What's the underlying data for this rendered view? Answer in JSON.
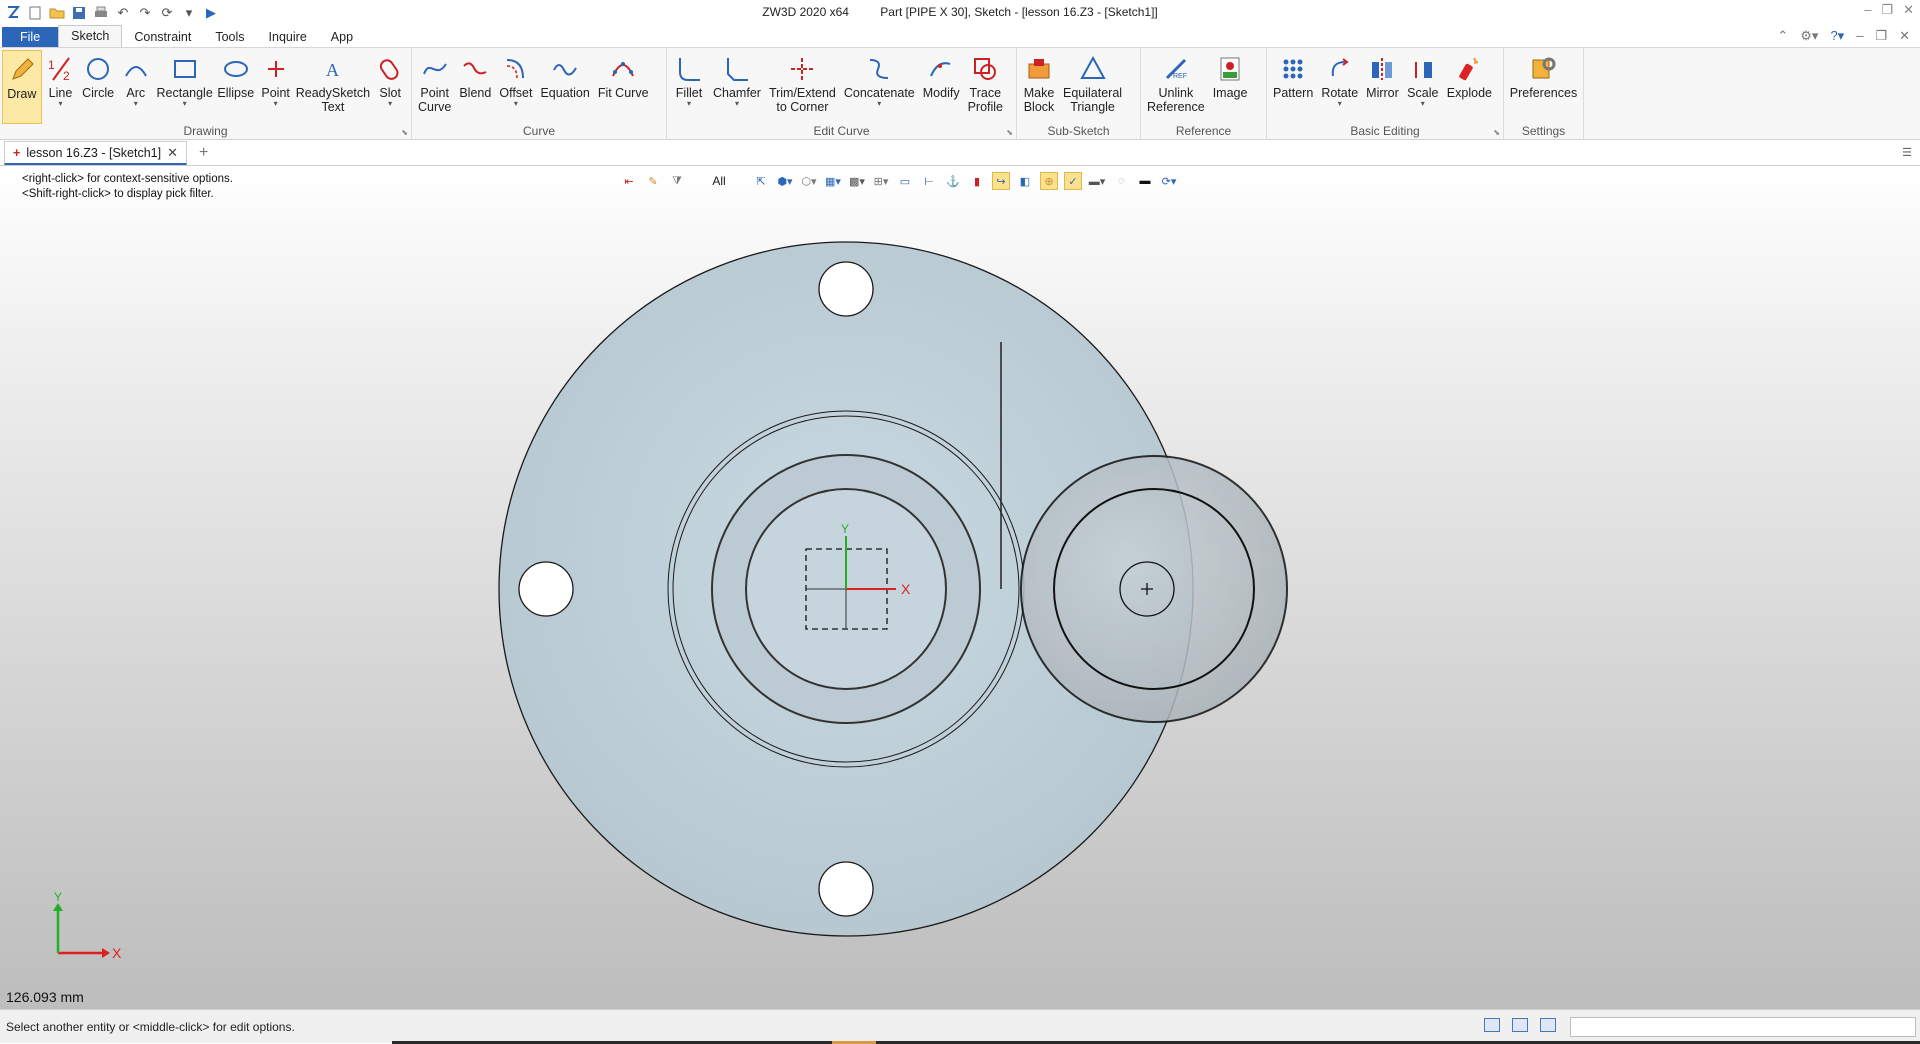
{
  "window": {
    "app_title": "ZW3D 2020 x64",
    "doc_title": "Part [PIPE X 30],  Sketch - [lesson 16.Z3 - [Sketch1]]"
  },
  "menu": {
    "tabs": [
      "File",
      "Sketch",
      "Constraint",
      "Tools",
      "Inquire",
      "App"
    ],
    "active": "Sketch"
  },
  "ribbon": {
    "groups": [
      {
        "title": "Drawing",
        "buttons": [
          {
            "label": "Draw"
          },
          {
            "label": "Line"
          },
          {
            "label": "Circle"
          },
          {
            "label": "Arc"
          },
          {
            "label": "Rectangle"
          },
          {
            "label": "Ellipse"
          },
          {
            "label": "Point"
          },
          {
            "label": "ReadySketch",
            "label2": "Text"
          },
          {
            "label": "Slot"
          }
        ]
      },
      {
        "title": "Curve",
        "buttons": [
          {
            "label": "Point",
            "label2": "Curve"
          },
          {
            "label": "Blend"
          },
          {
            "label": "Offset"
          },
          {
            "label": "Equation"
          },
          {
            "label": "Fit Curve"
          }
        ]
      },
      {
        "title": "Edit Curve",
        "buttons": [
          {
            "label": "Fillet"
          },
          {
            "label": "Chamfer"
          },
          {
            "label": "Trim/Extend",
            "label2": "to Corner"
          },
          {
            "label": "Concatenate"
          },
          {
            "label": "Modify"
          },
          {
            "label": "Trace",
            "label2": "Profile"
          }
        ]
      },
      {
        "title": "Sub-Sketch",
        "buttons": [
          {
            "label": "Make",
            "label2": "Block"
          },
          {
            "label": "Equilateral",
            "label2": "Triangle"
          }
        ]
      },
      {
        "title": "Reference",
        "buttons": [
          {
            "label": "Unlink",
            "label2": "Reference"
          },
          {
            "label": "Image"
          }
        ]
      },
      {
        "title": "Basic Editing",
        "buttons": [
          {
            "label": "Pattern"
          },
          {
            "label": "Rotate"
          },
          {
            "label": "Mirror"
          },
          {
            "label": "Scale"
          },
          {
            "label": "Explode"
          }
        ]
      },
      {
        "title": "Settings",
        "buttons": [
          {
            "label": "Preferences"
          }
        ]
      }
    ]
  },
  "document_tab": {
    "label": "lesson 16.Z3 - [Sketch1]"
  },
  "viewport": {
    "hint1": "<right-click> for context-sensitive options.",
    "hint2": "<Shift-right-click> to display pick filter.",
    "filter": "All",
    "measurement": "126.093 mm",
    "axis_x": "X",
    "axis_y": "Y"
  },
  "status": {
    "message": "Select another entity or <middle-click> for edit options."
  }
}
